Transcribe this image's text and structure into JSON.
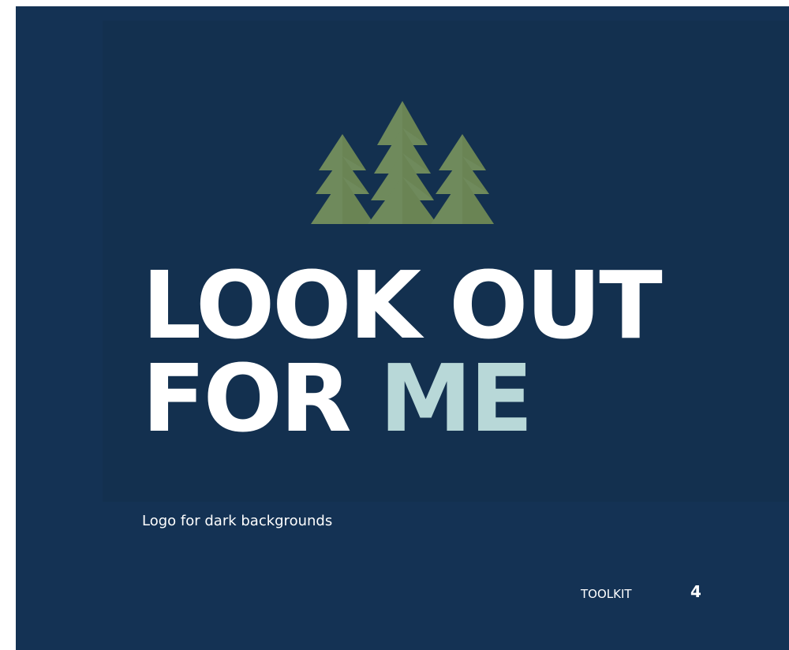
{
  "logo": {
    "line1": "LOOK OUT",
    "line2_main": "FOR",
    "line2_accent": "ME",
    "icon": "pine-trees-icon",
    "tree_color": "#6d8358",
    "accent_color": "#b8d8d8"
  },
  "caption": "Logo for dark backgrounds",
  "footer": {
    "label": "TOOLKIT",
    "page_number": "4"
  },
  "colors": {
    "background": "#143254",
    "text": "#ffffff"
  }
}
